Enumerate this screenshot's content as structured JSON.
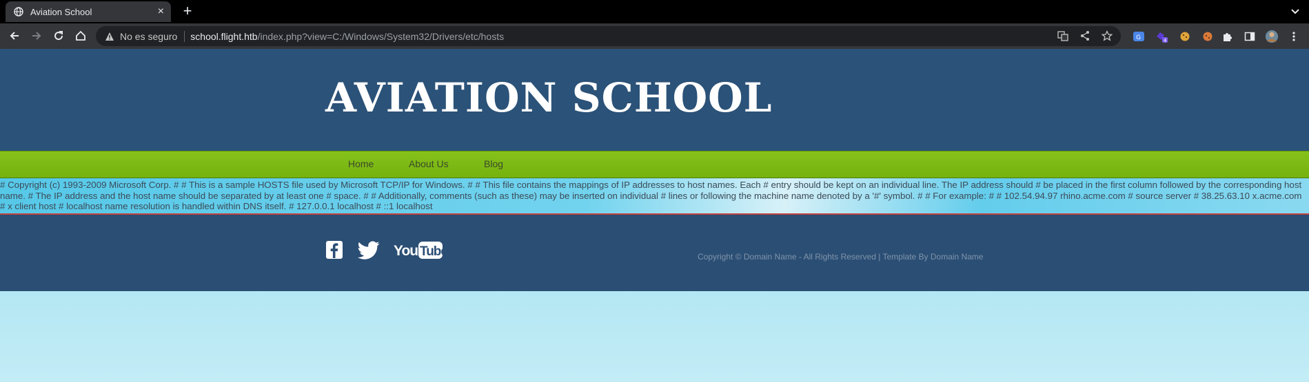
{
  "browser": {
    "tab_title": "Aviation School",
    "omnibox": {
      "security_label": "No es seguro",
      "host": "school.flight.htb",
      "path": "/index.php?view=C:/Windows/System32/Drivers/etc/hosts"
    },
    "extension_badge": "4"
  },
  "site": {
    "title": "AVIATION SCHOOL",
    "nav": [
      {
        "label": "Home"
      },
      {
        "label": "About Us"
      },
      {
        "label": "Blog"
      }
    ],
    "content_text": "# Copyright (c) 1993-2009 Microsoft Corp. # # This is a sample HOSTS file used by Microsoft TCP/IP for Windows. # # This file contains the mappings of IP addresses to host names. Each # entry should be kept on an individual line. The IP address should # be placed in the first column followed by the corresponding host name. # The IP address and the host name should be separated by at least one # space. # # Additionally, comments (such as these) may be inserted on individual # lines or following the machine name denoted by a '#' symbol. # # For example: # # 102.54.94.97 rhino.acme.com # source server # 38.25.63.10 x.acme.com # x client host # localhost name resolution is handled within DNS itself. # 127.0.0.1 localhost # ::1 localhost",
    "footer": {
      "copyright": "Copyright © Domain Name - All Rights Reserved | Template By Domain Name",
      "social": [
        "facebook-icon",
        "twitter-icon",
        "youtube-icon"
      ],
      "youtube_text": "YouTube"
    }
  },
  "colors": {
    "header": "#2b5278",
    "nav": "#7cb815",
    "footer": "#2b4e74",
    "sky": "#8fdcee"
  }
}
